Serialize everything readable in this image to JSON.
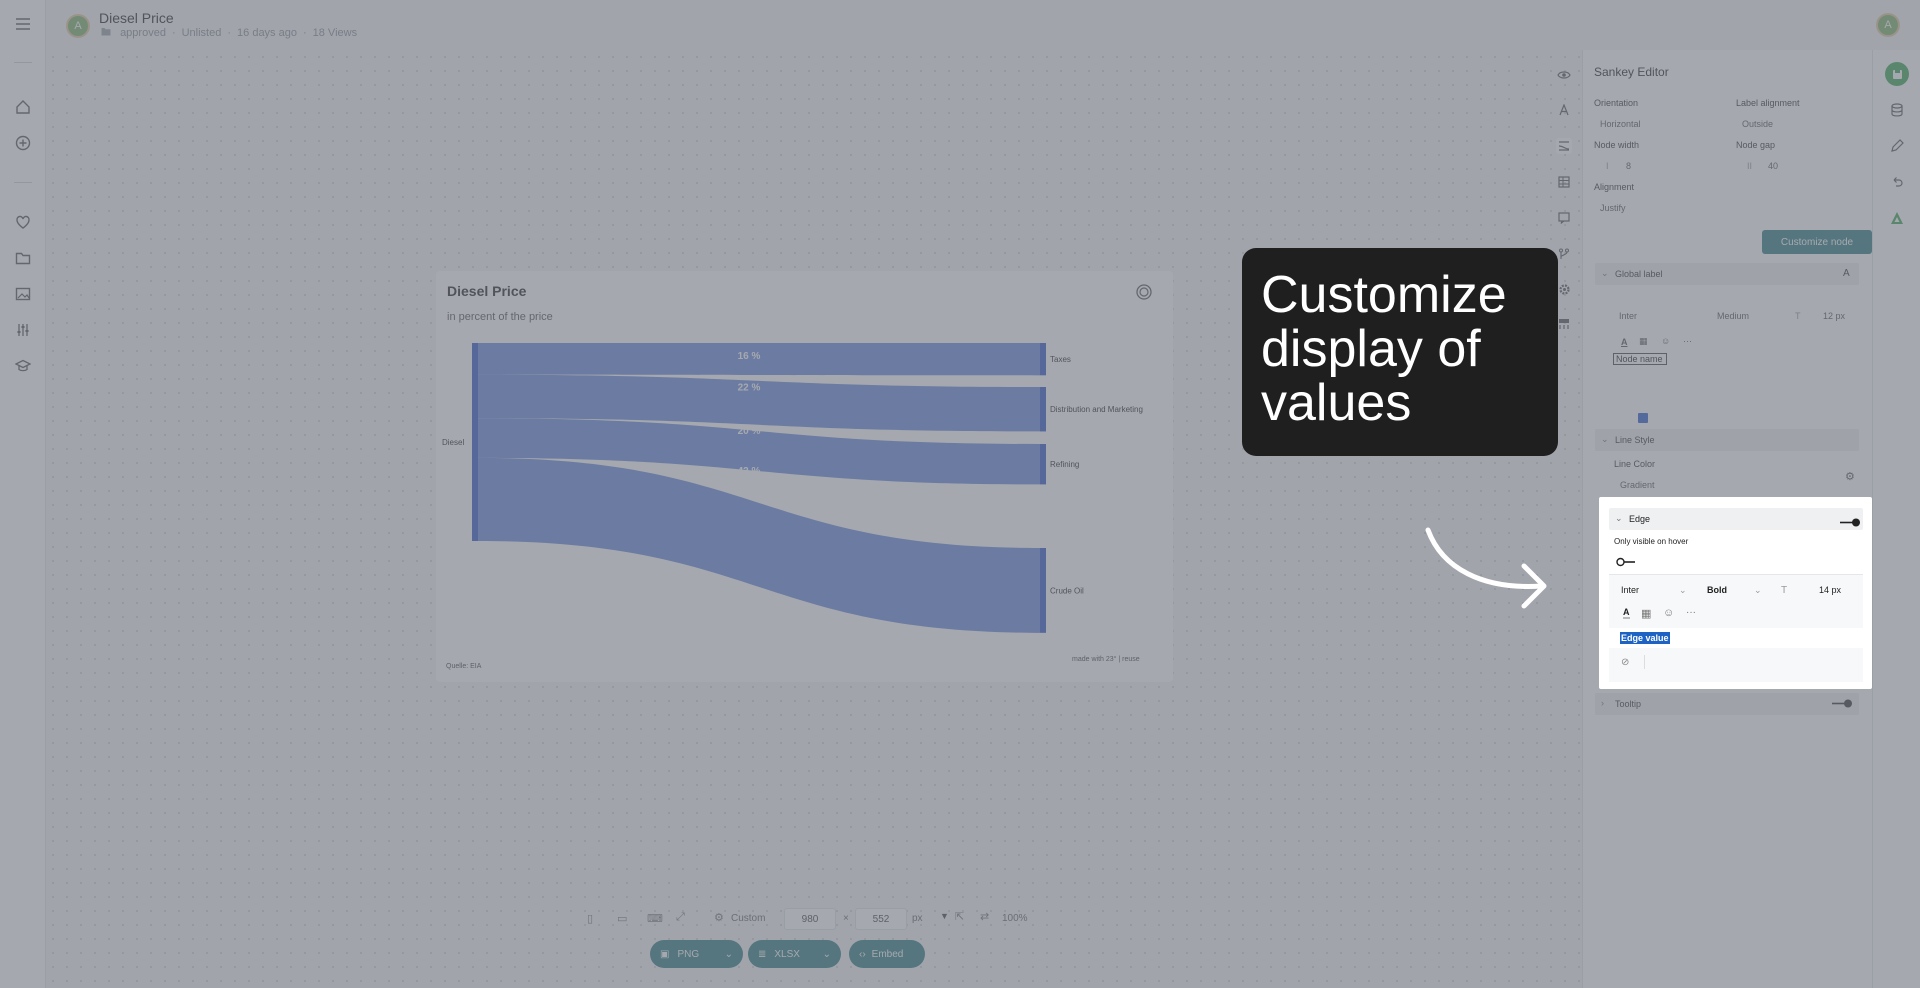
{
  "document": {
    "title": "Diesel Price",
    "avatar_letter": "A",
    "meta": {
      "folder": "approved",
      "visibility": "Unlisted",
      "age": "16 days ago",
      "views": "18 Views"
    }
  },
  "user": {
    "avatar_letter": "A"
  },
  "chart_data": {
    "type": "sankey",
    "title": "Diesel Price",
    "subtitle": "in percent of the price",
    "source": "Quelle: EIA",
    "credit": "made with 23° | reuse",
    "logo_text": "23°",
    "source_node": "Diesel",
    "flows": [
      {
        "target": "Taxes",
        "value": 16,
        "label": "16 %"
      },
      {
        "target": "Distribution and Marketing",
        "value": 22,
        "label": "22 %"
      },
      {
        "target": "Refining",
        "value": 20,
        "label": "20 %"
      },
      {
        "target": "Crude Oil",
        "value": 42,
        "label": "42 %"
      }
    ],
    "color": "#4a6fd8"
  },
  "editor": {
    "title": "Sankey Editor",
    "orientation": {
      "label": "Orientation",
      "value": "Horizontal"
    },
    "label_alignment": {
      "label": "Label alignment",
      "value": "Outside"
    },
    "node_width": {
      "label": "Node width",
      "value": "8"
    },
    "node_gap": {
      "label": "Node gap",
      "value": "40"
    },
    "alignment": {
      "label": "Alignment",
      "value": "Justify"
    },
    "customize_node_button": "Customize node",
    "global_label": {
      "header": "Global label",
      "font": "Inter",
      "weight": "Medium",
      "size": "12 px",
      "format_text": "Node name",
      "color": "#2a5ad0"
    },
    "line_style": {
      "header": "Line Style",
      "line_color_label": "Line Color",
      "line_color_value": "Gradient"
    },
    "edge": {
      "header": "Edge",
      "hover_label": "Only visible on hover",
      "font": "Inter",
      "weight": "Bold",
      "size": "14 px",
      "format_text": "Edge value"
    },
    "tooltip": {
      "header": "Tooltip"
    }
  },
  "callout": {
    "text": "Customize display of values"
  },
  "bottom": {
    "preset": "Custom",
    "width": "980",
    "height": "552",
    "times": "×",
    "unit": "px",
    "zoom": "100%",
    "export_png": "PNG",
    "export_xlsx": "XLSX",
    "embed": "Embed"
  },
  "colors": {
    "accent": "#2f7b84",
    "save": "#3aa655",
    "brand": "#3aa655"
  }
}
